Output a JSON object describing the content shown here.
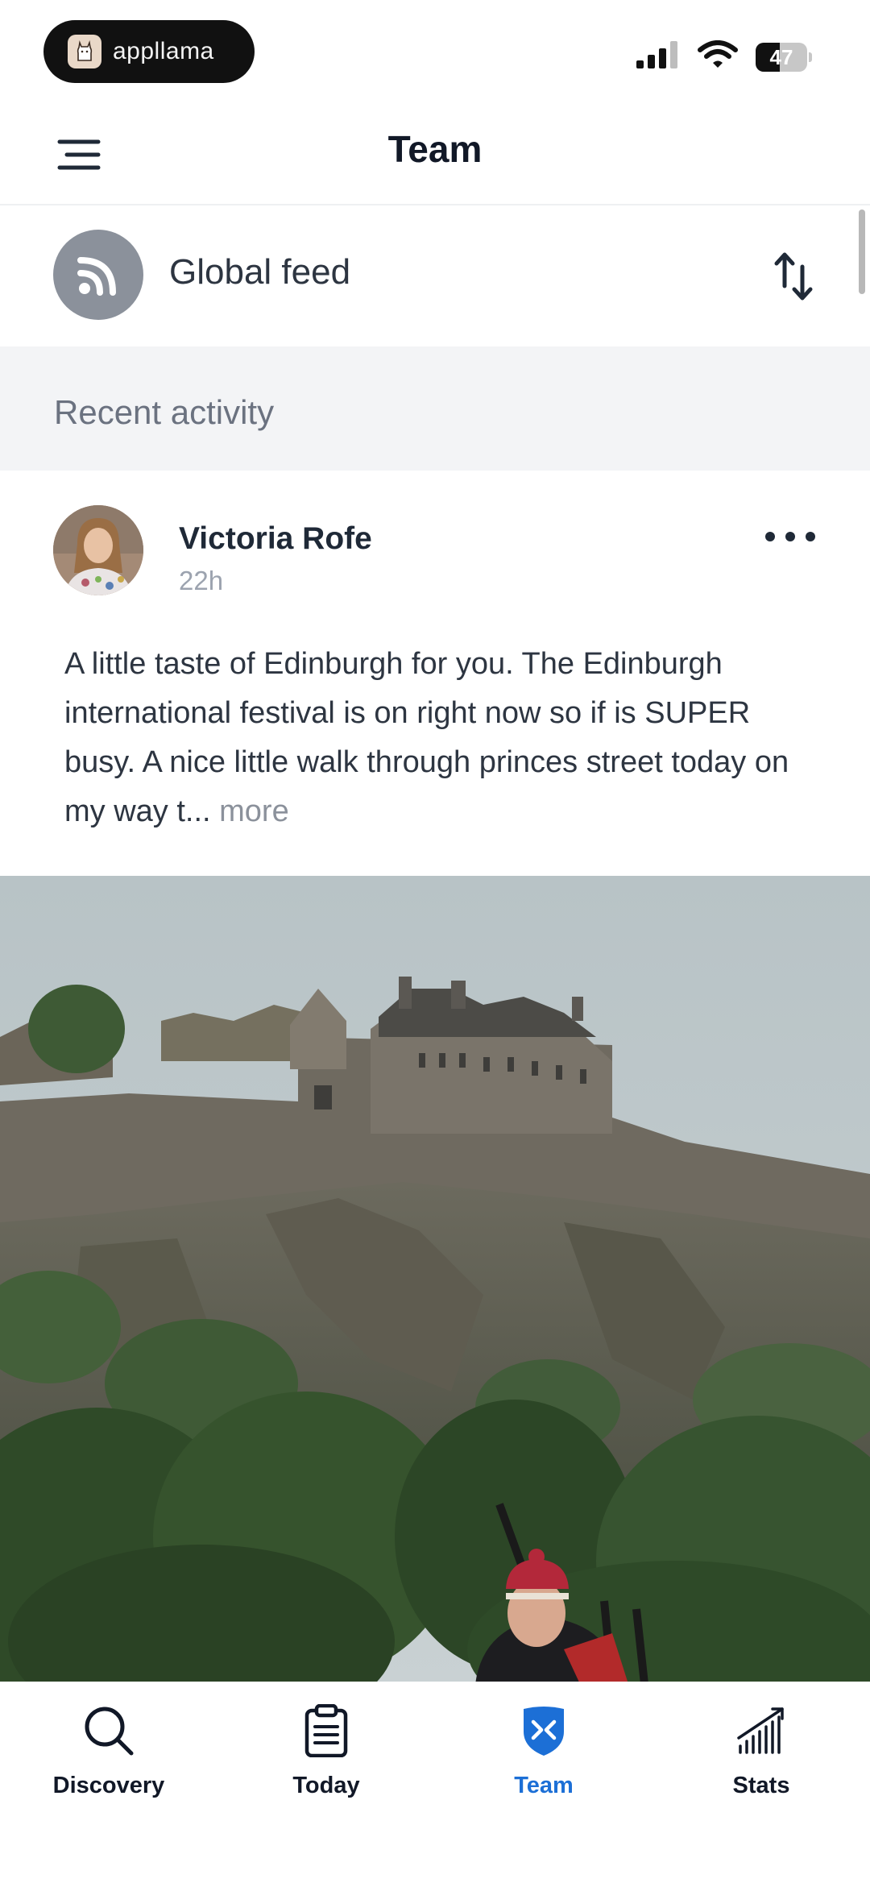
{
  "status_bar": {
    "app_name": "appllama",
    "battery": "47",
    "battery_level": 0.47,
    "icons": [
      "cellular-signal-icon",
      "wifi-icon",
      "battery-icon"
    ]
  },
  "header": {
    "title": "Team",
    "menu_icon": "hamburger-menu-icon"
  },
  "feed_selector": {
    "label": "Global feed",
    "icon": "rss-feed-icon",
    "sort_icon": "sort-arrows-icon"
  },
  "section": {
    "title": "Recent activity"
  },
  "post": {
    "author": "Victoria Rofe",
    "time": "22h",
    "text": "A little taste of Edinburgh for you. The Edinburgh international festival is on right now so if is SUPER busy. A nice little walk through princes street today on my way t... ",
    "more": "more",
    "options_icon": "more-horizontal-icon"
  },
  "tab_bar": {
    "tabs": [
      {
        "label": "Discovery",
        "icon": "search-icon",
        "active": false
      },
      {
        "label": "Today",
        "icon": "clipboard-icon",
        "active": false
      },
      {
        "label": "Team",
        "icon": "team-shield-icon",
        "active": true
      },
      {
        "label": "Stats",
        "icon": "stats-chart-icon",
        "active": false
      }
    ]
  },
  "colors": {
    "accent": "#1c6fd6",
    "section_bg": "#f3f4f6",
    "feed_icon_bg": "#8b919b"
  }
}
